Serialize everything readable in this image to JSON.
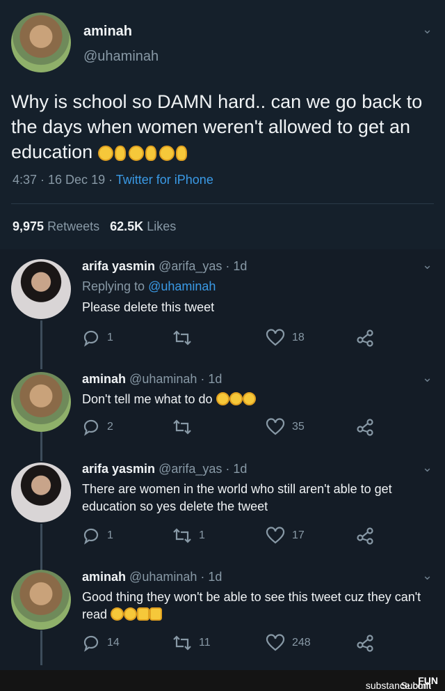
{
  "main_tweet": {
    "name": "aminah",
    "handle": "@uhaminah",
    "text": "Why is school so DAMN hard.. can we go back to the days when women weren't allowed to get an education",
    "time": "4:37 · 16 Dec 19 · ",
    "source": "Twitter for iPhone",
    "retweets_count": "9,975",
    "retweets_label": "Retweets",
    "likes_count": "62.5K",
    "likes_label": "Likes"
  },
  "replies": [
    {
      "name": "arifa yasmin",
      "handle": "@arifa_yas · 1d",
      "replying_prefix": "Replying to ",
      "replying_to": "@uhaminah",
      "text": "Please delete this tweet",
      "replies": "1",
      "retweets": "",
      "likes": "18"
    },
    {
      "name": "aminah",
      "handle": "@uhaminah · 1d",
      "text": "Don't tell me what to do",
      "replies": "2",
      "retweets": "",
      "likes": "35"
    },
    {
      "name": "arifa yasmin",
      "handle": "@arifa_yas · 1d",
      "text": "There are women in the world who still aren't able to get education so yes delete the tweet",
      "replies": "1",
      "retweets": "1",
      "likes": "17"
    },
    {
      "name": "aminah",
      "handle": "@uhaminah · 1d",
      "text": "Good thing they won't be able to see this tweet cuz they can't read",
      "replies": "14",
      "retweets": "11",
      "likes": "248"
    }
  ],
  "footer": {
    "prefix": "Submit your pics at ",
    "brand_bold": "FUN",
    "brand_rest": "substance.com"
  },
  "icons": [
    "chevron-down-icon",
    "reply-icon",
    "retweet-icon",
    "like-icon",
    "share-icon"
  ],
  "colors": {
    "background": "#15202b",
    "link": "#3a9ae6",
    "muted": "#8899a6"
  }
}
